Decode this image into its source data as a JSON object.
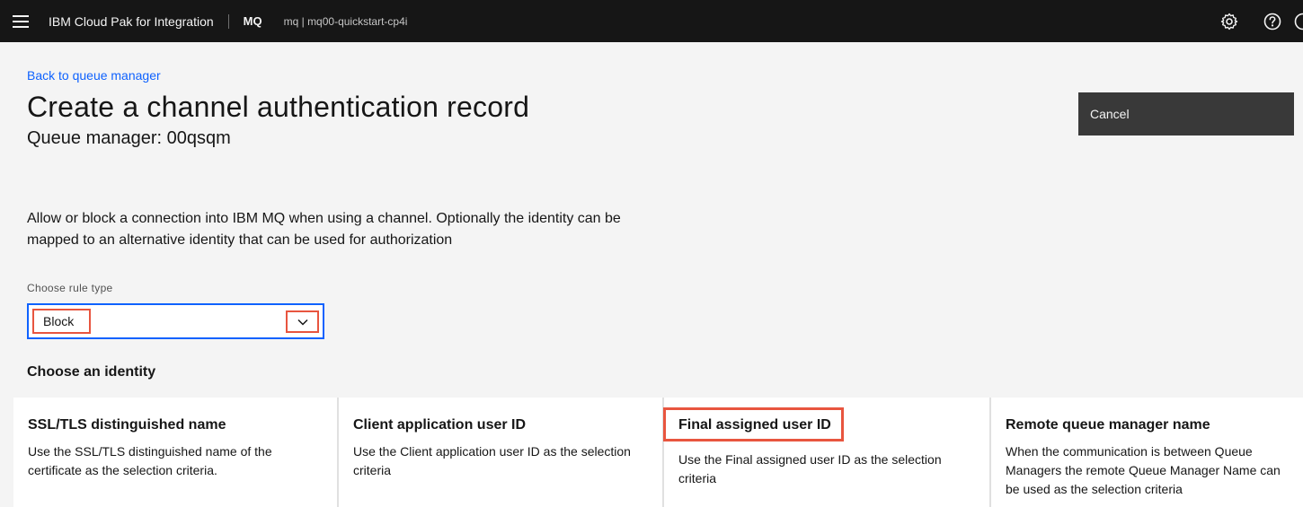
{
  "header": {
    "brand": "IBM Cloud Pak for Integration",
    "product": "MQ",
    "instance": "mq | mq00-quickstart-cp4i",
    "icons": [
      "settings-icon",
      "help-icon",
      "user-icon"
    ]
  },
  "page": {
    "back_link": "Back to queue manager",
    "title": "Create a channel authentication record",
    "subtitle": "Queue manager: 00qsqm",
    "cancel_label": "Cancel",
    "description": "Allow or block a connection into IBM MQ when using a channel. Optionally the identity can be mapped to an alternative identity that can be used for authorization"
  },
  "rule_type": {
    "label": "Choose rule type",
    "selected": "Block"
  },
  "identity": {
    "heading": "Choose an identity",
    "cards": [
      {
        "title": "SSL/TLS distinguished name",
        "description": "Use the SSL/TLS distinguished name of the certificate as the selection criteria."
      },
      {
        "title": "Client application user ID",
        "description": "Use the Client application user ID as the selection criteria"
      },
      {
        "title": "Final assigned user ID",
        "description": "Use the Final assigned user ID as the selection criteria"
      },
      {
        "title": "Remote queue manager name",
        "description": "When the communication is between Queue Managers the remote Queue Manager Name can be used as the selection criteria"
      }
    ]
  },
  "colors": {
    "header_bg": "#161616",
    "link": "#0f62fe",
    "highlight": "#e8553f",
    "button_bg": "#393939"
  }
}
